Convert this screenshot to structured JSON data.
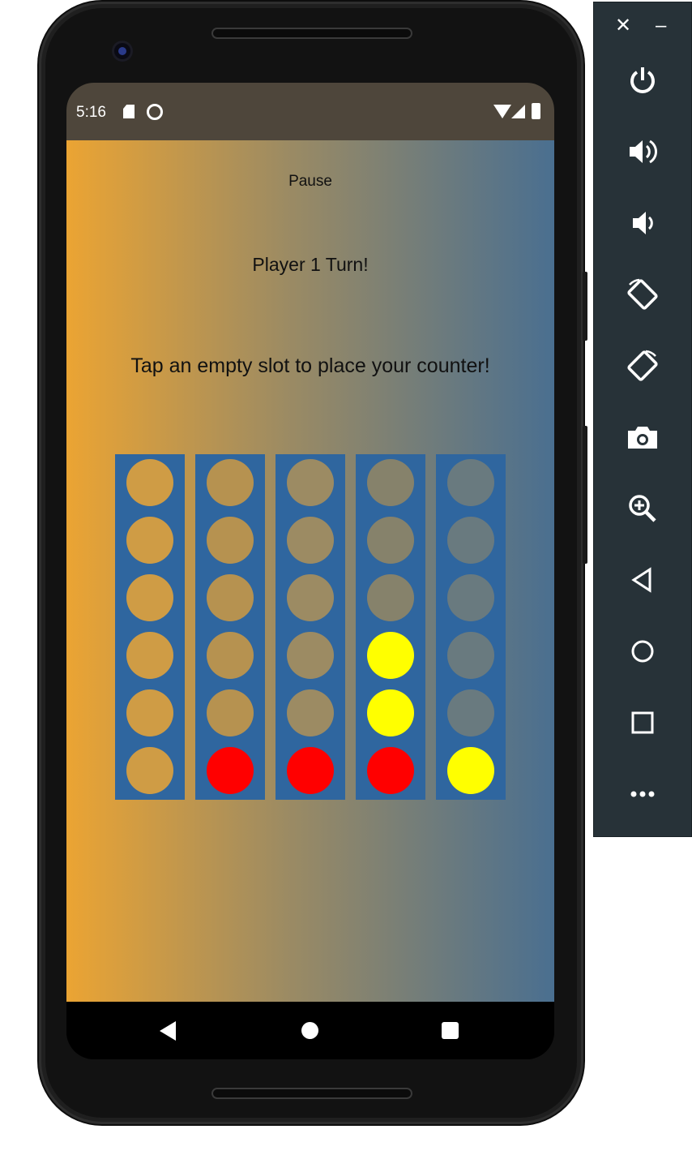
{
  "status_bar": {
    "time": "5:16",
    "icons": [
      "sd-card-icon",
      "sync-icon",
      "wifi-icon",
      "signal-icon",
      "battery-icon"
    ]
  },
  "app": {
    "pause_label": "Pause",
    "turn_text": "Player 1 Turn!",
    "instruction_text": "Tap an empty slot to place your counter!",
    "colors": {
      "gradient_start": "#eba433",
      "gradient_end": "#4a6f90",
      "board": "#2f669f",
      "red": "#ff0000",
      "yellow": "#ffff00"
    },
    "board": {
      "columns": 5,
      "rows": 6,
      "grid": [
        [
          "empty",
          "empty",
          "empty",
          "empty",
          "empty"
        ],
        [
          "empty",
          "empty",
          "empty",
          "empty",
          "empty"
        ],
        [
          "empty",
          "empty",
          "empty",
          "empty",
          "empty"
        ],
        [
          "empty",
          "empty",
          "empty",
          "yellow",
          "empty"
        ],
        [
          "empty",
          "empty",
          "empty",
          "yellow",
          "empty"
        ],
        [
          "empty",
          "red",
          "red",
          "red",
          "yellow"
        ]
      ]
    }
  },
  "nav_bar": {
    "buttons": [
      "back-icon",
      "home-icon",
      "recents-icon"
    ]
  },
  "emulator_toolbar": {
    "close_label": "✕",
    "minimize_label": "–",
    "buttons": [
      "power-icon",
      "volume-up-icon",
      "volume-down-icon",
      "rotate-left-icon",
      "rotate-right-icon",
      "camera-icon",
      "zoom-icon",
      "back-icon",
      "home-icon",
      "overview-icon",
      "more-icon"
    ]
  }
}
